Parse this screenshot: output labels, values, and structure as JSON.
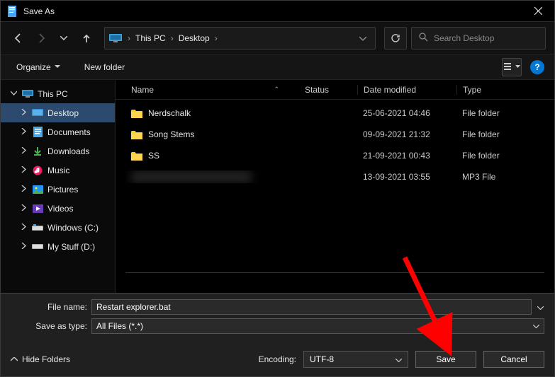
{
  "title": "Save As",
  "breadcrumb": {
    "root": "This PC",
    "current": "Desktop"
  },
  "search": {
    "placeholder": "Search Desktop"
  },
  "toolbar": {
    "organize": "Organize",
    "newfolder": "New folder"
  },
  "columns": {
    "name": "Name",
    "status": "Status",
    "date": "Date modified",
    "type": "Type"
  },
  "tree": {
    "root": "This PC",
    "items": [
      {
        "label": "Desktop"
      },
      {
        "label": "Documents"
      },
      {
        "label": "Downloads"
      },
      {
        "label": "Music"
      },
      {
        "label": "Pictures"
      },
      {
        "label": "Videos"
      },
      {
        "label": "Windows (C:)"
      },
      {
        "label": "My Stuff (D:)"
      }
    ]
  },
  "files": [
    {
      "name": "Nerdschalk",
      "date": "25-06-2021 04:46",
      "type": "File folder",
      "kind": "folder"
    },
    {
      "name": "Song Stems",
      "date": "09-09-2021 21:32",
      "type": "File folder",
      "kind": "folder"
    },
    {
      "name": "SS",
      "date": "21-09-2021 00:43",
      "type": "File folder",
      "kind": "folder"
    },
    {
      "name": "",
      "date": "13-09-2021 03:55",
      "type": "MP3 File",
      "kind": "redacted"
    }
  ],
  "form": {
    "filename_label": "File name:",
    "filename_value": "Restart explorer.bat",
    "type_label": "Save as type:",
    "type_value": "All Files  (*.*)"
  },
  "footer": {
    "hide": "Hide Folders",
    "encoding_label": "Encoding:",
    "encoding_value": "UTF-8",
    "save": "Save",
    "cancel": "Cancel"
  }
}
